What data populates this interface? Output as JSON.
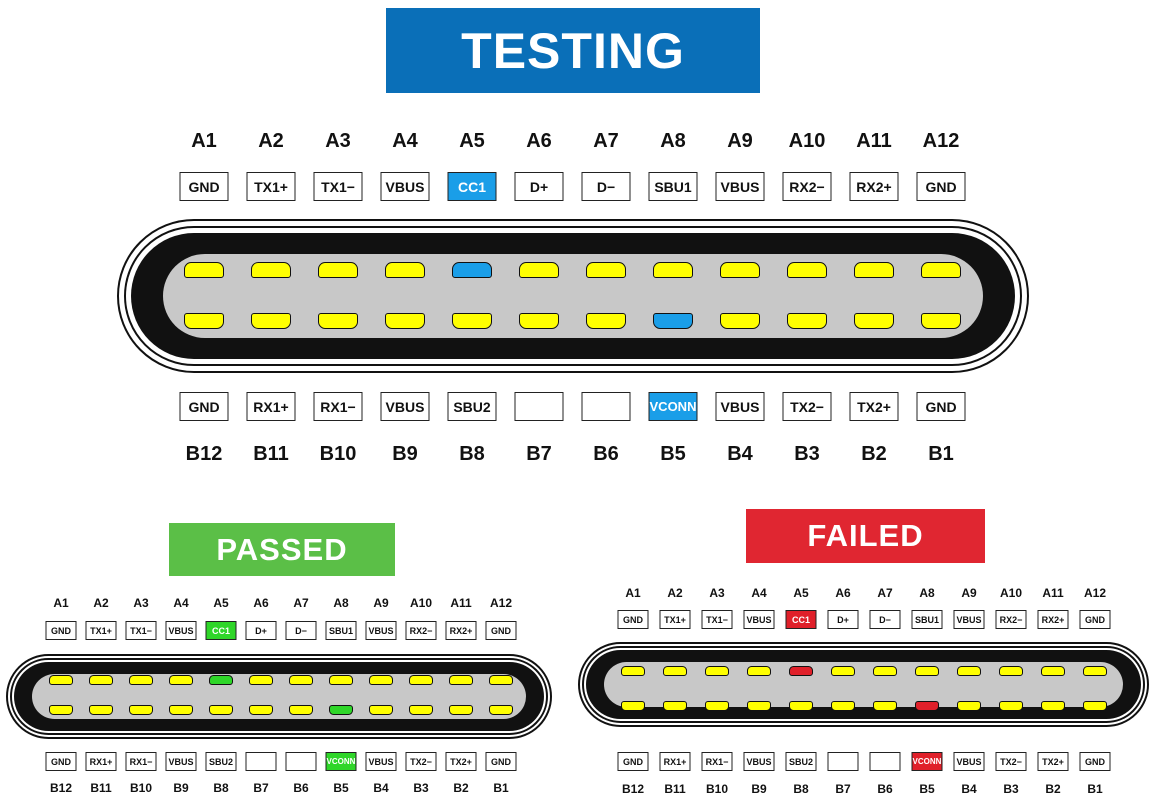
{
  "banners": {
    "testing": "TESTING",
    "passed": "PASSED",
    "failed": "FAILED"
  },
  "colors": {
    "testing_banner": "#0a6fb8",
    "passed_banner": "#5bbf47",
    "failed_banner": "#e02631",
    "pin_default": "#ffff00",
    "testing_highlight": "#1a9ee8",
    "passed_highlight": "#2fd629",
    "failed_highlight": "#e0202a",
    "connector_body": "#111111",
    "tongue": "#c8c8c8"
  },
  "top_pins": [
    "A1",
    "A2",
    "A3",
    "A4",
    "A5",
    "A6",
    "A7",
    "A8",
    "A9",
    "A10",
    "A11",
    "A12"
  ],
  "top_signals": [
    "GND",
    "TX1+",
    "TX1−",
    "VBUS",
    "CC1",
    "D+",
    "D−",
    "SBU1",
    "VBUS",
    "RX2−",
    "RX2+",
    "GND"
  ],
  "bottom_pins": [
    "B12",
    "B11",
    "B10",
    "B9",
    "B8",
    "B7",
    "B6",
    "B5",
    "B4",
    "B3",
    "B2",
    "B1"
  ],
  "bottom_signals": [
    "GND",
    "RX1+",
    "RX1−",
    "VBUS",
    "SBU2",
    "",
    "",
    "VCONN",
    "VBUS",
    "TX2−",
    "TX2+",
    "GND"
  ],
  "highlight": {
    "top_index": 4,
    "bottom_index": 7
  },
  "panels": [
    {
      "id": "testing",
      "state": "testing"
    },
    {
      "id": "passed",
      "state": "passed"
    },
    {
      "id": "failed",
      "state": "failed"
    }
  ]
}
